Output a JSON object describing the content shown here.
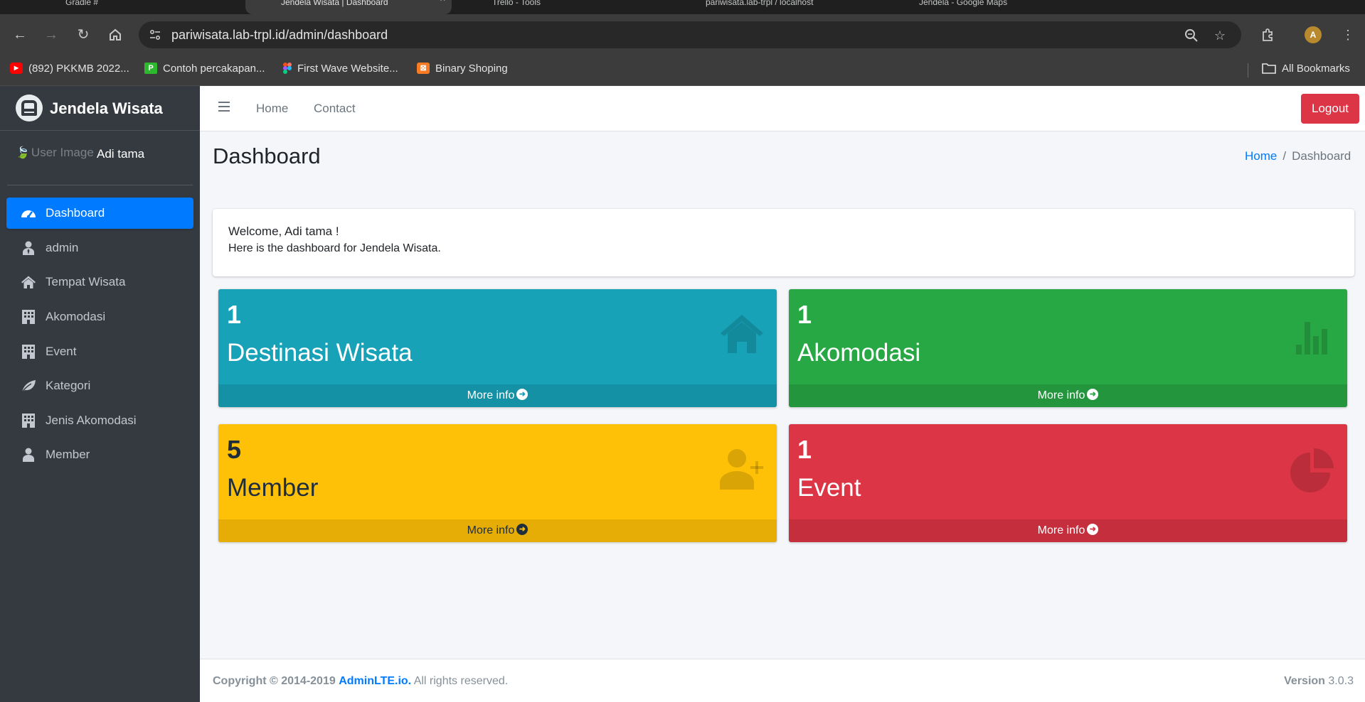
{
  "browser": {
    "tabs": [
      {
        "label": "Gradle #"
      },
      {
        "label": "Jendela Wisata | Dashboard"
      },
      {
        "label": "Trello - Tools"
      },
      {
        "label": "pariwisata.lab-trpl / localhost"
      },
      {
        "label": "Jendela - Google Maps"
      }
    ],
    "url": "pariwisata.lab-trpl.id/admin/dashboard",
    "profile_initial": "A",
    "bookmarks": [
      {
        "label": "(892) PKKMB 2022...",
        "color": "#ff0000",
        "glyph": "▶"
      },
      {
        "label": "Contoh percakapan...",
        "color": "#2eb82e",
        "glyph": "P"
      },
      {
        "label": "First Wave Website...",
        "color": "#a259ff",
        "glyph": "✦"
      },
      {
        "label": "Binary Shoping",
        "color": "#fb7a24",
        "glyph": "⊠"
      }
    ],
    "all_bookmarks": "All Bookmarks"
  },
  "sidebar": {
    "brand": "Jendela Wisata",
    "user_image_alt": "User Image",
    "user_name": "Adi tama",
    "items": [
      {
        "label": "Dashboard",
        "icon": "tachometer-icon"
      },
      {
        "label": "admin",
        "icon": "user-tie-icon"
      },
      {
        "label": "Tempat Wisata",
        "icon": "home-icon"
      },
      {
        "label": "Akomodasi",
        "icon": "building-icon"
      },
      {
        "label": "Event",
        "icon": "building-icon"
      },
      {
        "label": "Kategori",
        "icon": "leaf-icon"
      },
      {
        "label": "Jenis Akomodasi",
        "icon": "building-icon"
      },
      {
        "label": "Member",
        "icon": "user-icon"
      }
    ]
  },
  "navbar": {
    "home": "Home",
    "contact": "Contact",
    "logout": "Logout"
  },
  "content": {
    "title": "Dashboard",
    "breadcrumb": {
      "home": "Home",
      "separator": "/",
      "current": "Dashboard"
    },
    "welcome": {
      "line1": "Welcome, Adi tama !",
      "line2": "Here is the dashboard for Jendela Wisata."
    },
    "boxes": [
      {
        "count": "1",
        "label": "Destinasi Wisata",
        "more": "More info",
        "color": "#17a2b8",
        "icon": "home-icon"
      },
      {
        "count": "1",
        "label": "Akomodasi",
        "more": "More info",
        "color": "#28a745",
        "icon": "bar-chart-icon"
      },
      {
        "count": "5",
        "label": "Member",
        "more": "More info",
        "color": "#ffc107",
        "icon": "user-plus-icon"
      },
      {
        "count": "1",
        "label": "Event",
        "more": "More info",
        "color": "#dc3545",
        "icon": "pie-chart-icon"
      }
    ]
  },
  "footer": {
    "copyright_prefix": "Copyright © 2014-2019",
    "brand": "AdminLTE.io.",
    "rights": "All rights reserved.",
    "version_label": "Version",
    "version_value": "3.0.3"
  }
}
